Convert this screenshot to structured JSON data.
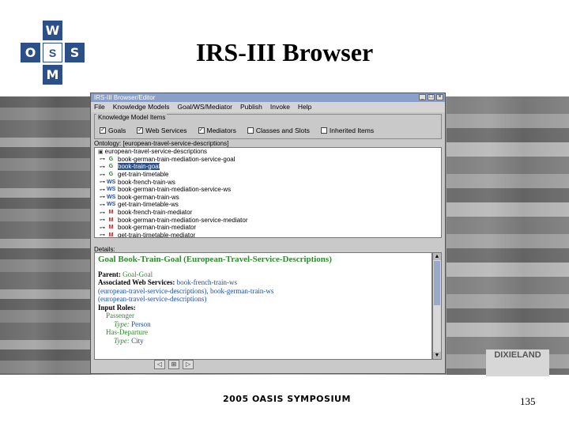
{
  "logo": {
    "top": "W",
    "left": "O",
    "center": "S",
    "right": "S",
    "bottom": "M"
  },
  "slide_title": "IRS-III Browser",
  "photo_sign": "DIXIELAND",
  "window": {
    "title": "IRS-III Browser/Editor",
    "menu": [
      "File",
      "Knowledge Models",
      "Goal/WS/Mediator",
      "Publish",
      "Invoke",
      "Help"
    ],
    "kmi_title": "Knowledge Model Items",
    "checkboxes": [
      {
        "label": "Goals",
        "checked": "✓"
      },
      {
        "label": "Web Services",
        "checked": "✓"
      },
      {
        "label": "Mediators",
        "checked": "✓"
      },
      {
        "label": "Classes and Slots",
        "checked": ""
      },
      {
        "label": "Inherited Items",
        "checked": ""
      }
    ],
    "ontology_label": "Ontology: [european-travel-service-descriptions]",
    "tree": {
      "root": "european-travel-service-descriptions",
      "items": [
        {
          "badge": "G",
          "text": "book-german-train-mediation-service-goal"
        },
        {
          "badge": "G",
          "text": "book-train-goal"
        },
        {
          "badge": "G",
          "text": "get-train-timetable"
        },
        {
          "badge": "WS",
          "text": "book-french-train-ws"
        },
        {
          "badge": "WS",
          "text": "book-german-train-mediation-service-ws"
        },
        {
          "badge": "WS",
          "text": "book-german-train-ws"
        },
        {
          "badge": "WS",
          "text": "get-train-timetable-ws"
        },
        {
          "badge": "M",
          "text": "book-french-train-mediator"
        },
        {
          "badge": "M",
          "text": "book-german-train-mediation-service-mediator"
        },
        {
          "badge": "M",
          "text": "book-german-train-mediator"
        },
        {
          "badge": "M",
          "text": "get-train-timetable-mediator"
        }
      ]
    },
    "details_label": "Details:",
    "details": {
      "goal_label": "Goal Book-Train-Goal",
      "goal_ontology": "(European-Travel-Service-Descriptions)",
      "parent_label": "Parent:",
      "parent_value": "Goal-Goal",
      "aws_label": "Associated Web Services:",
      "aws_ws1": "book-french-train-ws",
      "aws_line2a": "(european-travel-service-descriptions),",
      "aws_ws2": "book-german-train-ws",
      "aws_line3": "(european-travel-service-descriptions)",
      "input_roles": "Input Roles:",
      "role1": "Passenger",
      "type_label": "Type:",
      "role1_type": "Person",
      "role2": "Has-Departure",
      "role2_type": "City"
    },
    "nav": [
      "◁",
      "⊞",
      "▷"
    ]
  },
  "footer": "2005 OASIS SYMPOSIUM",
  "page_number": "135",
  "colors": {
    "logo_blue": "#2b4f86",
    "selection": "#2b4f86",
    "goal_green": "#2e8b2e",
    "link_blue": "#1e4ea6"
  }
}
